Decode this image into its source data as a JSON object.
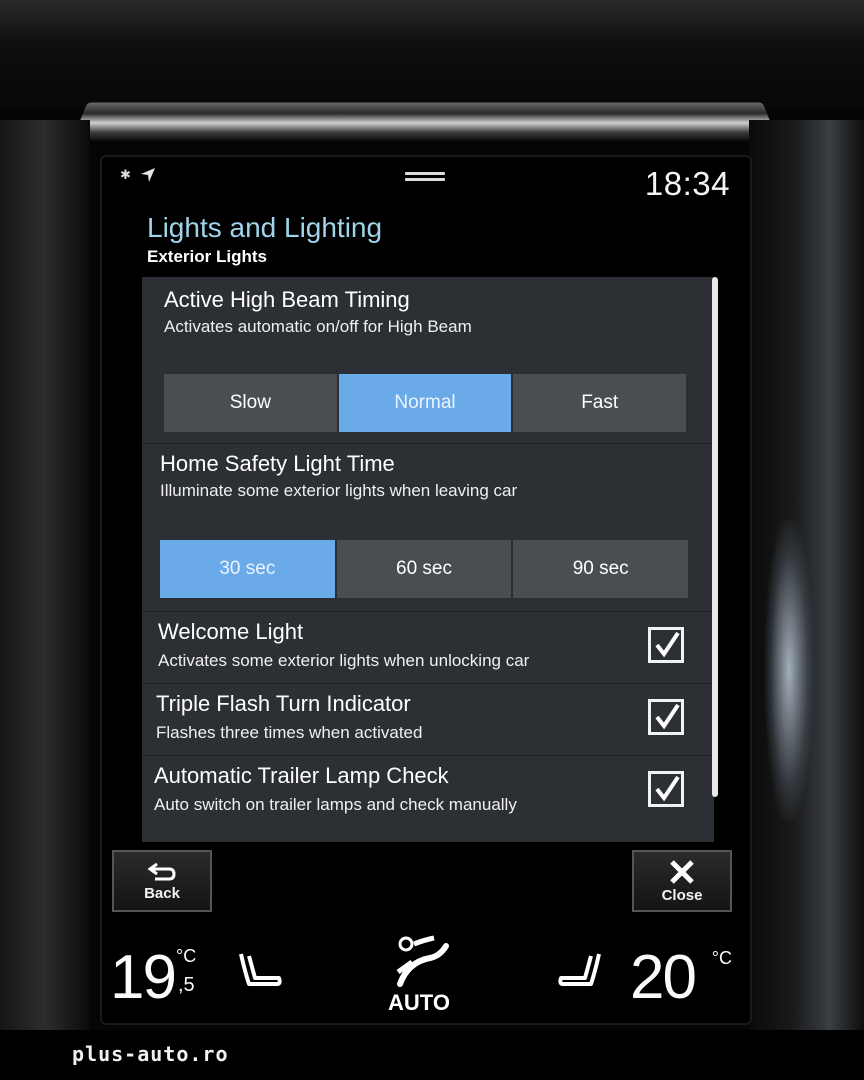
{
  "status_bar": {
    "time": "18:34",
    "icons": [
      "bluetooth-icon",
      "navigation-arrow-icon",
      "pull-down-handle-icon"
    ]
  },
  "header": {
    "title": "Lights and Lighting",
    "subtitle": "Exterior Lights"
  },
  "settings": {
    "high_beam": {
      "title": "Active High Beam Timing",
      "description": "Activates automatic on/off for High Beam",
      "options": [
        "Slow",
        "Normal",
        "Fast"
      ],
      "selected": "Normal"
    },
    "home_safety": {
      "title": "Home Safety Light Time",
      "description": "Illuminate some exterior lights when leaving car",
      "options": [
        "30 sec",
        "60 sec",
        "90 sec"
      ],
      "selected": "30 sec"
    },
    "toggles": [
      {
        "title": "Welcome Light",
        "description": "Activates some exterior lights when unlocking car",
        "checked": true
      },
      {
        "title": "Triple Flash Turn Indicator",
        "description": "Flashes three times when activated",
        "checked": true
      },
      {
        "title": "Automatic Trailer Lamp Check",
        "description": "Auto switch on trailer lamps and check manually",
        "checked": true
      }
    ]
  },
  "footer": {
    "back_label": "Back",
    "close_label": "Close"
  },
  "climate": {
    "left_temp": "19",
    "left_temp_decimal": ",5",
    "left_unit": "°C",
    "right_temp": "20",
    "right_unit": "°C",
    "mode_label": "AUTO",
    "icons": [
      "seat-heat-left-icon",
      "fan-airflow-icon",
      "seat-heat-right-icon"
    ]
  },
  "watermark": "plus-auto.ro",
  "colors": {
    "accent_selected": "#6aaae8",
    "title": "#9fd4ea",
    "panel": "#2c2f33",
    "button": "#4a4d52"
  }
}
